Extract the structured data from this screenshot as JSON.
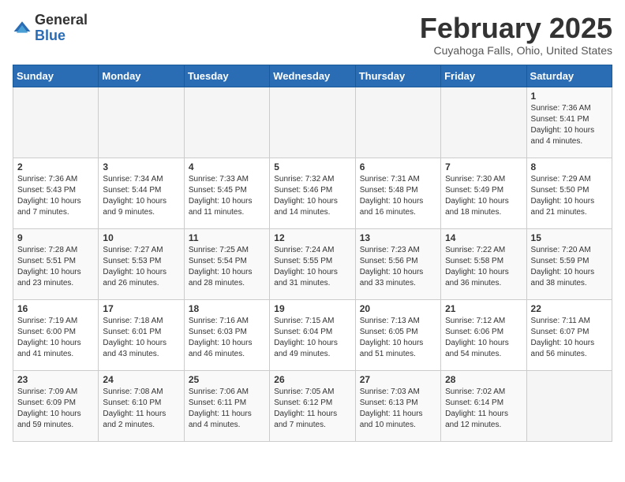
{
  "logo": {
    "general": "General",
    "blue": "Blue"
  },
  "title": "February 2025",
  "location": "Cuyahoga Falls, Ohio, United States",
  "days_of_week": [
    "Sunday",
    "Monday",
    "Tuesday",
    "Wednesday",
    "Thursday",
    "Friday",
    "Saturday"
  ],
  "weeks": [
    [
      {
        "day": "",
        "info": ""
      },
      {
        "day": "",
        "info": ""
      },
      {
        "day": "",
        "info": ""
      },
      {
        "day": "",
        "info": ""
      },
      {
        "day": "",
        "info": ""
      },
      {
        "day": "",
        "info": ""
      },
      {
        "day": "1",
        "info": "Sunrise: 7:36 AM\nSunset: 5:41 PM\nDaylight: 10 hours\nand 4 minutes."
      }
    ],
    [
      {
        "day": "2",
        "info": "Sunrise: 7:36 AM\nSunset: 5:43 PM\nDaylight: 10 hours\nand 7 minutes."
      },
      {
        "day": "3",
        "info": "Sunrise: 7:34 AM\nSunset: 5:44 PM\nDaylight: 10 hours\nand 9 minutes."
      },
      {
        "day": "4",
        "info": "Sunrise: 7:33 AM\nSunset: 5:45 PM\nDaylight: 10 hours\nand 11 minutes."
      },
      {
        "day": "5",
        "info": "Sunrise: 7:32 AM\nSunset: 5:46 PM\nDaylight: 10 hours\nand 14 minutes."
      },
      {
        "day": "6",
        "info": "Sunrise: 7:31 AM\nSunset: 5:48 PM\nDaylight: 10 hours\nand 16 minutes."
      },
      {
        "day": "7",
        "info": "Sunrise: 7:30 AM\nSunset: 5:49 PM\nDaylight: 10 hours\nand 18 minutes."
      },
      {
        "day": "8",
        "info": "Sunrise: 7:29 AM\nSunset: 5:50 PM\nDaylight: 10 hours\nand 21 minutes."
      }
    ],
    [
      {
        "day": "9",
        "info": "Sunrise: 7:28 AM\nSunset: 5:51 PM\nDaylight: 10 hours\nand 23 minutes."
      },
      {
        "day": "10",
        "info": "Sunrise: 7:27 AM\nSunset: 5:53 PM\nDaylight: 10 hours\nand 26 minutes."
      },
      {
        "day": "11",
        "info": "Sunrise: 7:25 AM\nSunset: 5:54 PM\nDaylight: 10 hours\nand 28 minutes."
      },
      {
        "day": "12",
        "info": "Sunrise: 7:24 AM\nSunset: 5:55 PM\nDaylight: 10 hours\nand 31 minutes."
      },
      {
        "day": "13",
        "info": "Sunrise: 7:23 AM\nSunset: 5:56 PM\nDaylight: 10 hours\nand 33 minutes."
      },
      {
        "day": "14",
        "info": "Sunrise: 7:22 AM\nSunset: 5:58 PM\nDaylight: 10 hours\nand 36 minutes."
      },
      {
        "day": "15",
        "info": "Sunrise: 7:20 AM\nSunset: 5:59 PM\nDaylight: 10 hours\nand 38 minutes."
      }
    ],
    [
      {
        "day": "16",
        "info": "Sunrise: 7:19 AM\nSunset: 6:00 PM\nDaylight: 10 hours\nand 41 minutes."
      },
      {
        "day": "17",
        "info": "Sunrise: 7:18 AM\nSunset: 6:01 PM\nDaylight: 10 hours\nand 43 minutes."
      },
      {
        "day": "18",
        "info": "Sunrise: 7:16 AM\nSunset: 6:03 PM\nDaylight: 10 hours\nand 46 minutes."
      },
      {
        "day": "19",
        "info": "Sunrise: 7:15 AM\nSunset: 6:04 PM\nDaylight: 10 hours\nand 49 minutes."
      },
      {
        "day": "20",
        "info": "Sunrise: 7:13 AM\nSunset: 6:05 PM\nDaylight: 10 hours\nand 51 minutes."
      },
      {
        "day": "21",
        "info": "Sunrise: 7:12 AM\nSunset: 6:06 PM\nDaylight: 10 hours\nand 54 minutes."
      },
      {
        "day": "22",
        "info": "Sunrise: 7:11 AM\nSunset: 6:07 PM\nDaylight: 10 hours\nand 56 minutes."
      }
    ],
    [
      {
        "day": "23",
        "info": "Sunrise: 7:09 AM\nSunset: 6:09 PM\nDaylight: 10 hours\nand 59 minutes."
      },
      {
        "day": "24",
        "info": "Sunrise: 7:08 AM\nSunset: 6:10 PM\nDaylight: 11 hours\nand 2 minutes."
      },
      {
        "day": "25",
        "info": "Sunrise: 7:06 AM\nSunset: 6:11 PM\nDaylight: 11 hours\nand 4 minutes."
      },
      {
        "day": "26",
        "info": "Sunrise: 7:05 AM\nSunset: 6:12 PM\nDaylight: 11 hours\nand 7 minutes."
      },
      {
        "day": "27",
        "info": "Sunrise: 7:03 AM\nSunset: 6:13 PM\nDaylight: 11 hours\nand 10 minutes."
      },
      {
        "day": "28",
        "info": "Sunrise: 7:02 AM\nSunset: 6:14 PM\nDaylight: 11 hours\nand 12 minutes."
      },
      {
        "day": "",
        "info": ""
      }
    ]
  ]
}
